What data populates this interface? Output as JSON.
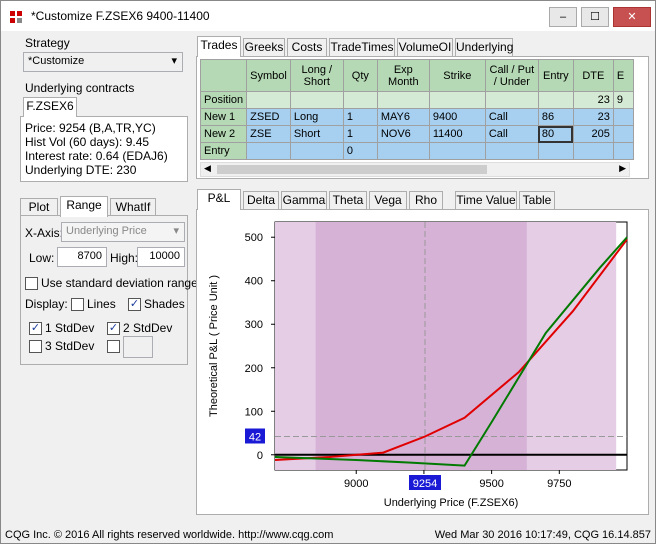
{
  "window": {
    "title": "*Customize F.ZSEX6 9400-11400",
    "min": "–",
    "max": "☐",
    "close": "✕"
  },
  "strategy": {
    "label": "Strategy",
    "value": "*Customize"
  },
  "underlying": {
    "label": "Underlying contracts",
    "tab": "F.ZSEX6",
    "price": "Price: 9254 (B,A,TR,YC)",
    "hist_vol": "Hist Vol (60 days): 9.45",
    "interest": "Interest rate: 0.64 (EDAJ6)",
    "dte": "Underlying DTE: 230"
  },
  "left_tabs": [
    "Plot",
    "Range",
    "WhatIf"
  ],
  "range": {
    "xaxis_label": "X-Axis:",
    "xaxis_value": "Underlying Price",
    "low_label": "Low:",
    "low_value": "8700",
    "high_label": "High:",
    "high_value": "10000",
    "std_label": "Use standard deviation range.",
    "display_label": "Display:",
    "lines_label": "Lines",
    "shades_label": "Shades",
    "sd1": "1 StdDev",
    "sd2": "2 StdDev",
    "sd3": "3 StdDev"
  },
  "top_tabs": [
    "Trades",
    "Greeks",
    "Costs",
    "TradeTimes",
    "VolumeOI",
    "Underlying"
  ],
  "table": {
    "headers": [
      "",
      "Symbol",
      "Long / Short",
      "Qty",
      "Exp Month",
      "Strike",
      "Call / Put / Under",
      "Entry",
      "DTE",
      "E"
    ],
    "rows": [
      [
        "Position",
        "",
        "",
        "",
        "",
        "",
        "",
        "",
        "23",
        "9"
      ],
      [
        "New 1",
        "ZSED",
        "Long",
        "1",
        "MAY6",
        "9400",
        "Call",
        "86",
        "23",
        ""
      ],
      [
        "New 2",
        "ZSE",
        "Short",
        "1",
        "NOV6",
        "11400",
        "Call",
        "80",
        "205",
        ""
      ],
      [
        "Entry",
        "",
        "",
        "0",
        "",
        "",
        "",
        "",
        "",
        ""
      ]
    ]
  },
  "bottom_tabs": [
    "P&L",
    "Delta",
    "Gamma",
    "Theta",
    "Vega",
    "Rho",
    "Time Value",
    "Table"
  ],
  "chart_data": {
    "type": "line",
    "xlabel": "Underlying Price (F.ZSEX6)",
    "ylabel": "Theoretical P&L ( Price Unit )",
    "xlim": [
      8700,
      10000
    ],
    "ylim": [
      -35,
      535
    ],
    "xticks": [
      9000,
      9250,
      9500,
      9750
    ],
    "xtick_labels": [
      "9000",
      "",
      "9500",
      "9750"
    ],
    "yticks": [
      0,
      100,
      200,
      300,
      400,
      500
    ],
    "current_x": "9254",
    "current_y": "42",
    "series": [
      {
        "color": "#e00000",
        "x": [
          8700,
          8900,
          9100,
          9254,
          9400,
          9600,
          9800,
          10000
        ],
        "y": [
          -12,
          -5,
          5,
          42,
          85,
          190,
          330,
          495
        ]
      },
      {
        "color": "#007a00",
        "x": [
          8700,
          9000,
          9200,
          9400,
          9500,
          9700,
          9900,
          10000
        ],
        "y": [
          -5,
          -12,
          -18,
          -25,
          75,
          280,
          430,
          500
        ]
      }
    ],
    "zero_line": "#000000",
    "shade_outer": "#e6cde6",
    "shade_inner": "#d7b2d7"
  },
  "status": {
    "left": "CQG Inc. © 2016 All rights reserved worldwide.  http://www.cqg.com",
    "right": "Wed Mar 30 2016 10:17:49, CQG 16.14.857"
  }
}
